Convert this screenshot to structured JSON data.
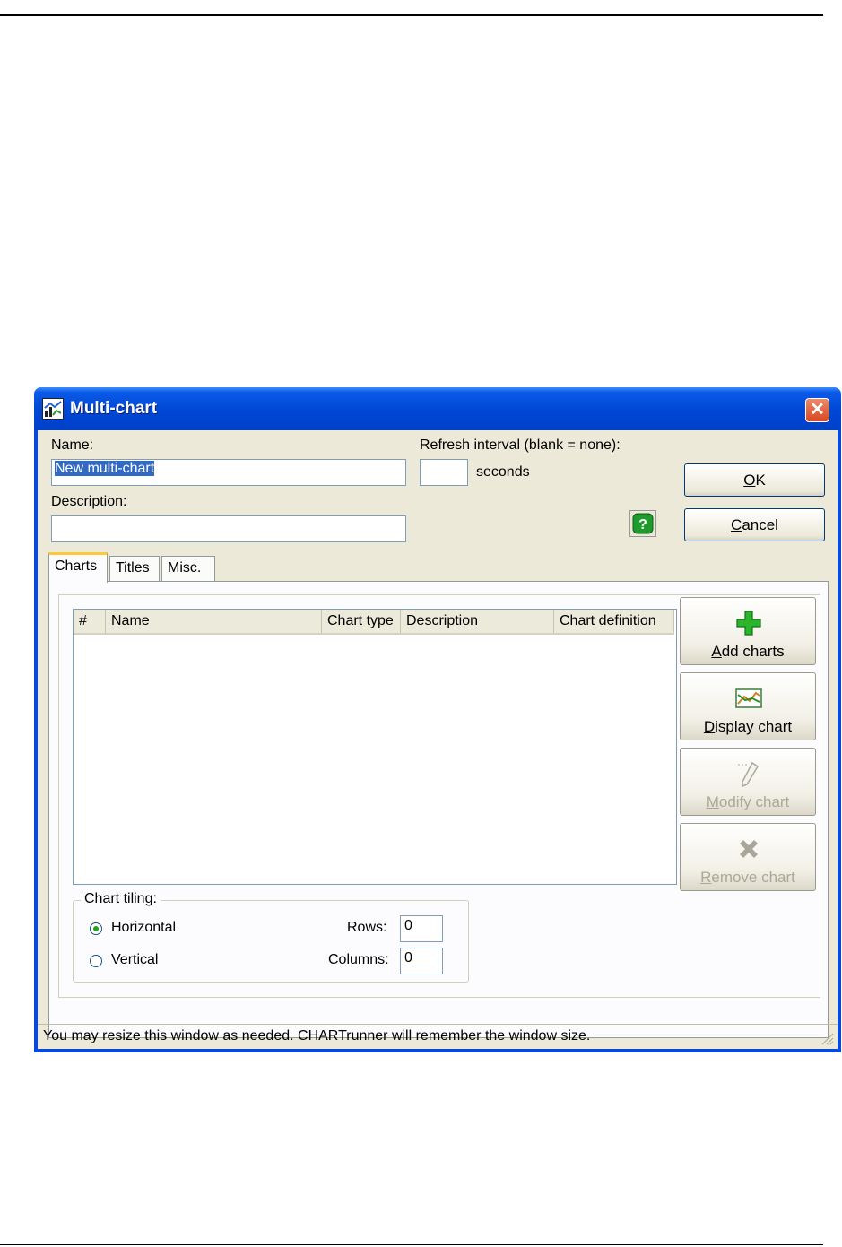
{
  "window": {
    "title": "Multi-chart",
    "close_glyph": "✕",
    "app_icon": "chart-icon"
  },
  "form": {
    "name_label": "Name:",
    "name_value": "New multi-chart",
    "description_label": "Description:",
    "description_value": "",
    "refresh_label": "Refresh interval (blank = none):",
    "refresh_value": "",
    "refresh_unit": "seconds",
    "help_icon": "help-icon"
  },
  "buttons": {
    "ok_prefix": "O",
    "ok_rest": "K",
    "cancel_prefix": "C",
    "cancel_rest": "ancel"
  },
  "tabs": [
    {
      "label": "Charts",
      "active": true
    },
    {
      "label": "Titles",
      "active": false
    },
    {
      "label": "Misc.",
      "active": false
    }
  ],
  "charts_table": {
    "columns": [
      "#",
      "Name",
      "Chart type",
      "Description",
      "Chart definition"
    ],
    "rows": []
  },
  "side_buttons": [
    {
      "prefix": "A",
      "rest": "dd charts",
      "icon": "plus-icon",
      "enabled": true
    },
    {
      "prefix": "D",
      "rest": "isplay chart",
      "icon": "chart-display-icon",
      "enabled": true
    },
    {
      "prefix": "M",
      "rest": "odify chart",
      "icon": "pencil-icon",
      "enabled": false
    },
    {
      "prefix": "R",
      "rest": "emove chart",
      "icon": "remove-x-icon",
      "enabled": false
    }
  ],
  "tiling": {
    "legend": "Chart tiling:",
    "horizontal_label": "Horizontal",
    "vertical_label": "Vertical",
    "selected": "Horizontal",
    "rows_label": "Rows:",
    "rows_value": "0",
    "columns_label": "Columns:",
    "columns_value": "0"
  },
  "status_text": "You may resize this window as needed. CHARTrunner will remember the window size.",
  "colors": {
    "titlebar": "#0046d5",
    "dialog_bg": "#ece9d8",
    "selection": "#316ac5",
    "tab_highlight": "#ffc83c"
  }
}
